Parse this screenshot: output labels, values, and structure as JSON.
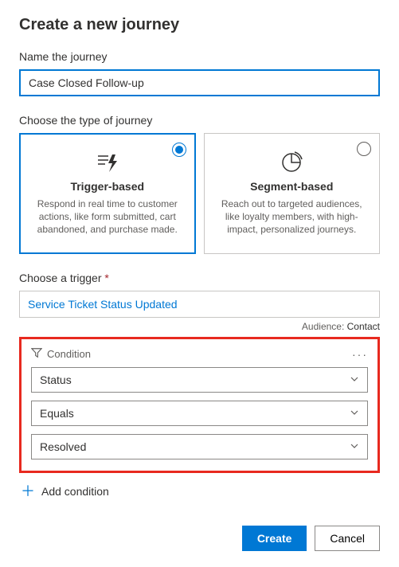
{
  "title": "Create a new journey",
  "nameSection": {
    "label": "Name the journey",
    "value": "Case Closed Follow-up"
  },
  "typeSection": {
    "label": "Choose the type of journey",
    "cards": [
      {
        "title": "Trigger-based",
        "desc": "Respond in real time to customer actions, like form submitted, cart abandoned, and purchase made.",
        "selected": true
      },
      {
        "title": "Segment-based",
        "desc": "Reach out to targeted audiences, like loyalty members, with high-impact, personalized journeys.",
        "selected": false
      }
    ]
  },
  "triggerSection": {
    "label": "Choose a trigger ",
    "required": "*",
    "value": "Service Ticket Status Updated",
    "audienceLabel": "Audience: ",
    "audienceValue": "Contact"
  },
  "condition": {
    "label": "Condition",
    "field": "Status",
    "operator": "Equals",
    "value": "Resolved"
  },
  "addConditionLabel": "Add condition",
  "footer": {
    "create": "Create",
    "cancel": "Cancel"
  }
}
